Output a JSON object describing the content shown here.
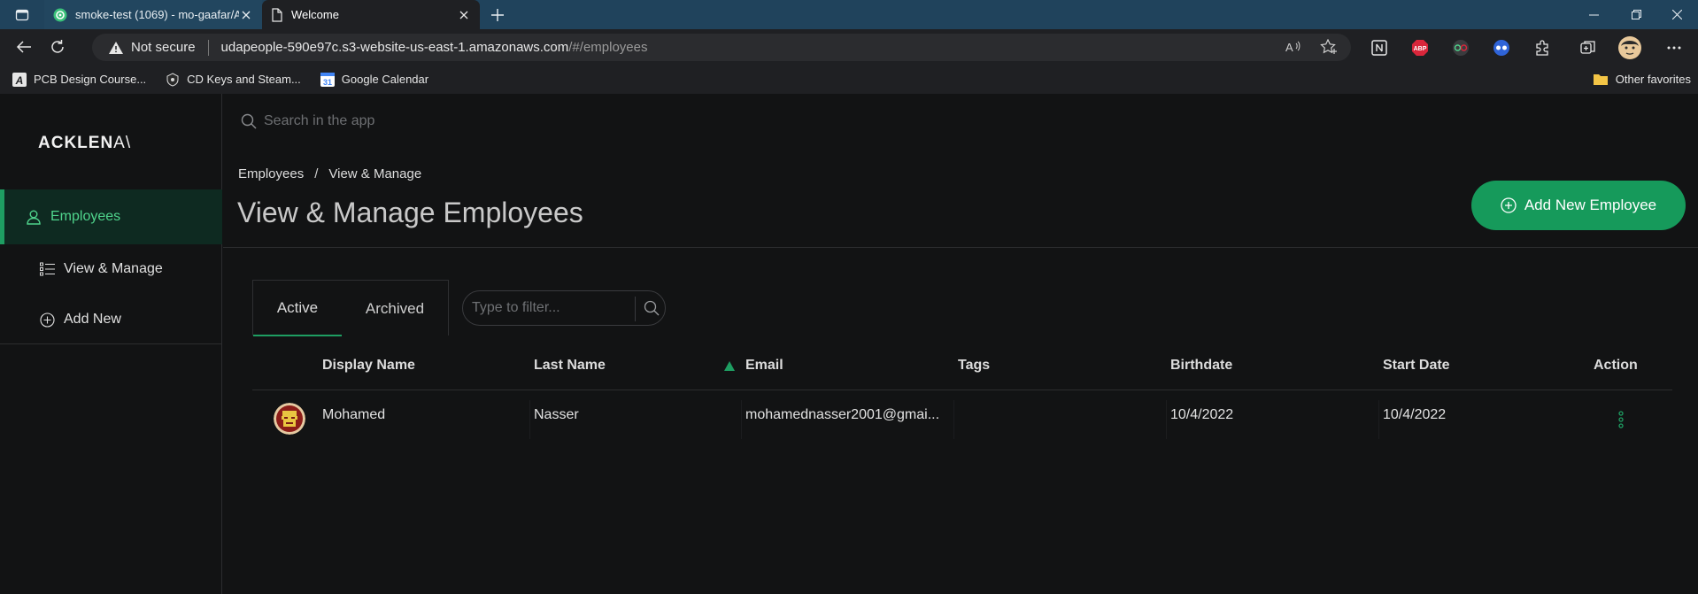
{
  "browser": {
    "tabs": [
      {
        "title": "smoke-test (1069) - mo-gaafar/A",
        "icon": "circleci-icon"
      },
      {
        "title": "Welcome",
        "icon": "page-icon"
      }
    ],
    "security_label": "Not secure",
    "url_host": "udapeople-590e97c.s3-website-us-east-1.amazonaws.com",
    "url_path": "/#/employees",
    "bookmarks": [
      {
        "label": "PCB Design Course..."
      },
      {
        "label": "CD Keys and Steam..."
      },
      {
        "label": "Google Calendar"
      }
    ],
    "other_favorites": "Other favorites"
  },
  "app": {
    "logo": "ACKLEN",
    "logo_suffix": "A\\",
    "search_placeholder": "Search in the app",
    "sidebar": {
      "section": "Employees",
      "items": [
        {
          "label": "View & Manage"
        },
        {
          "label": "Add New"
        }
      ]
    },
    "breadcrumb": {
      "root": "Employees",
      "separator": "/",
      "current": "View & Manage"
    },
    "page_title": "View & Manage Employees",
    "add_button": "Add New Employee",
    "tabs": [
      "Active",
      "Archived"
    ],
    "filter_placeholder": "Type to filter...",
    "table": {
      "columns": [
        "Display Name",
        "Last Name",
        "Email",
        "Tags",
        "Birthdate",
        "Start Date",
        "Action"
      ],
      "sort_column": "Email",
      "rows": [
        {
          "display_name": "Mohamed",
          "last_name": "Nasser",
          "email": "mohamednasser2001@gmai...",
          "tags": "",
          "birthdate": "10/4/2022",
          "start_date": "10/4/2022"
        }
      ]
    }
  },
  "colors": {
    "accent": "#169a5b",
    "accent_text": "#4fd48c",
    "background": "#121314",
    "tab_strip": "#20435c"
  }
}
